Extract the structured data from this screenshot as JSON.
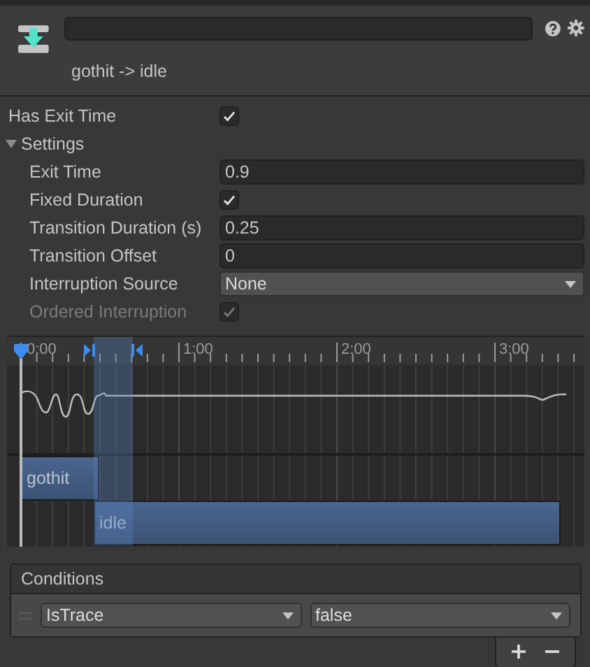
{
  "transition": {
    "title": "gothit -> idle"
  },
  "has_exit_time": {
    "label": "Has Exit Time",
    "checked": true
  },
  "settings": {
    "label": "Settings",
    "expanded": true,
    "rows": [
      {
        "kind": "number",
        "label": "Exit Time",
        "value": "0.9",
        "disabled": false
      },
      {
        "kind": "checkbox",
        "label": "Fixed Duration",
        "checked": true,
        "disabled": false
      },
      {
        "kind": "number",
        "label": "Transition Duration (s)",
        "value": "0.25",
        "disabled": false
      },
      {
        "kind": "number",
        "label": "Transition Offset",
        "value": "0",
        "disabled": false
      },
      {
        "kind": "dropdown",
        "label": "Interruption Source",
        "value": "None",
        "disabled": false
      },
      {
        "kind": "checkbox",
        "label": "Ordered Interruption",
        "checked": true,
        "disabled": true
      }
    ]
  },
  "timeline": {
    "ruler_labels": [
      "0:00",
      "1:00",
      "2:00",
      "3:00"
    ],
    "clips": [
      {
        "label": "gothit"
      },
      {
        "label": "idle"
      }
    ]
  },
  "conditions": {
    "title": "Conditions",
    "items": [
      {
        "parameter": "IsTrace",
        "value": "false"
      }
    ],
    "buttons": [
      "+",
      "−"
    ]
  }
}
